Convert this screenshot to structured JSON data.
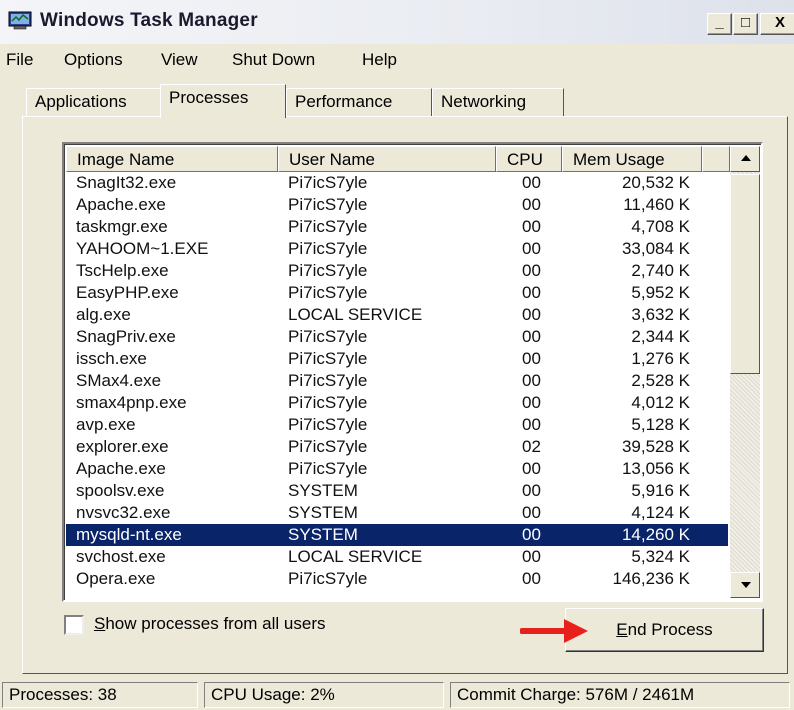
{
  "window": {
    "title": "Windows Task Manager",
    "minimize_glyph": "_",
    "maximize_glyph": "□",
    "close_glyph": "X"
  },
  "menu": [
    "File",
    "Options",
    "View",
    "Shut Down",
    "Help"
  ],
  "tabs": [
    {
      "label": "Applications",
      "active": false
    },
    {
      "label": "Processes",
      "active": true
    },
    {
      "label": "Performance",
      "active": false
    },
    {
      "label": "Networking",
      "active": false
    }
  ],
  "process_table": {
    "columns": [
      "Image Name",
      "User Name",
      "CPU",
      "Mem Usage"
    ],
    "rows": [
      [
        "SnagIt32.exe",
        "Pi7icS7yle",
        "00",
        "20,532 K"
      ],
      [
        "Apache.exe",
        "Pi7icS7yle",
        "00",
        "11,460 K"
      ],
      [
        "taskmgr.exe",
        "Pi7icS7yle",
        "00",
        "4,708 K"
      ],
      [
        "YAHOOM~1.EXE",
        "Pi7icS7yle",
        "00",
        "33,084 K"
      ],
      [
        "TscHelp.exe",
        "Pi7icS7yle",
        "00",
        "2,740 K"
      ],
      [
        "EasyPHP.exe",
        "Pi7icS7yle",
        "00",
        "5,952 K"
      ],
      [
        "alg.exe",
        "LOCAL SERVICE",
        "00",
        "3,632 K"
      ],
      [
        "SnagPriv.exe",
        "Pi7icS7yle",
        "00",
        "2,344 K"
      ],
      [
        "issch.exe",
        "Pi7icS7yle",
        "00",
        "1,276 K"
      ],
      [
        "SMax4.exe",
        "Pi7icS7yle",
        "00",
        "2,528 K"
      ],
      [
        "smax4pnp.exe",
        "Pi7icS7yle",
        "00",
        "4,012 K"
      ],
      [
        "avp.exe",
        "Pi7icS7yle",
        "00",
        "5,128 K"
      ],
      [
        "explorer.exe",
        "Pi7icS7yle",
        "02",
        "39,528 K"
      ],
      [
        "Apache.exe",
        "Pi7icS7yle",
        "00",
        "13,056 K"
      ],
      [
        "spoolsv.exe",
        "SYSTEM",
        "00",
        "5,916 K"
      ],
      [
        "nvsvc32.exe",
        "SYSTEM",
        "00",
        "4,124 K"
      ],
      [
        "mysqld-nt.exe",
        "SYSTEM",
        "00",
        "14,260 K"
      ],
      [
        "svchost.exe",
        "LOCAL SERVICE",
        "00",
        "5,324 K"
      ],
      [
        "Opera.exe",
        "Pi7icS7yle",
        "00",
        "146,236 K"
      ]
    ],
    "selected_row": 16
  },
  "show_all_users": {
    "label": "Show processes from all users",
    "checked": false
  },
  "end_process_label": "End Process",
  "status": {
    "processes": "Processes: 38",
    "cpu_usage": "CPU Usage: 2%",
    "commit_charge": "Commit Charge: 576M / 2461M"
  },
  "colors": {
    "selection": "#0a246a",
    "face": "#ece9d8",
    "annotation_arrow": "#e8201c"
  },
  "icons": [
    "task-manager-app-icon",
    "scroll-up-arrow-icon",
    "scroll-down-arrow-icon",
    "red-pointer-arrow-icon"
  ]
}
